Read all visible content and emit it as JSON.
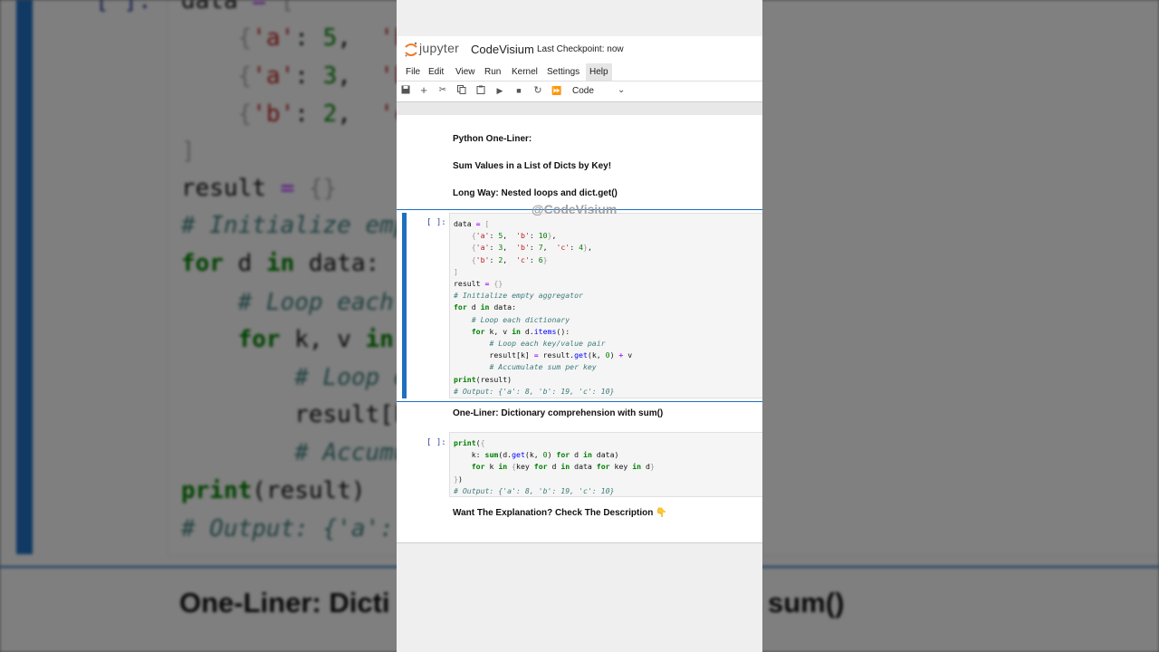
{
  "app": {
    "logo_text": "jupyter",
    "notebook_name": "CodeVisium",
    "checkpoint": "Last Checkpoint: now"
  },
  "menu": [
    "File",
    "Edit",
    "View",
    "Run",
    "Kernel",
    "Settings",
    "Help"
  ],
  "toolbar": {
    "cell_type": "Code",
    "icons": [
      "save-icon",
      "plus-icon",
      "cut-icon",
      "copy-icon",
      "paste-icon",
      "play-icon",
      "stop-icon",
      "restart-icon",
      "fast-forward-icon"
    ]
  },
  "cells": {
    "md1": "Python One-Liner:",
    "md2": "Sum Values in a List of Dicts by Key!",
    "md3": "Long Way: Nested loops and dict.get()",
    "code1_prompt": "[ ]:",
    "md4": "One-Liner: Dictionary comprehension with sum()",
    "code2_prompt": "[ ]:",
    "md5": "Want The Explanation? Check The Description"
  },
  "watermark": "@CodeVisium",
  "background": {
    "prompt": "[ ]:",
    "heading_left": "One-Liner: Dicti",
    "heading_right": "sum()"
  },
  "colors": {
    "accent": "#1f6fc0",
    "keyword": "#008000",
    "operator": "#aa22ff",
    "string": "#ba2121",
    "comment": "#3d7b7b"
  }
}
